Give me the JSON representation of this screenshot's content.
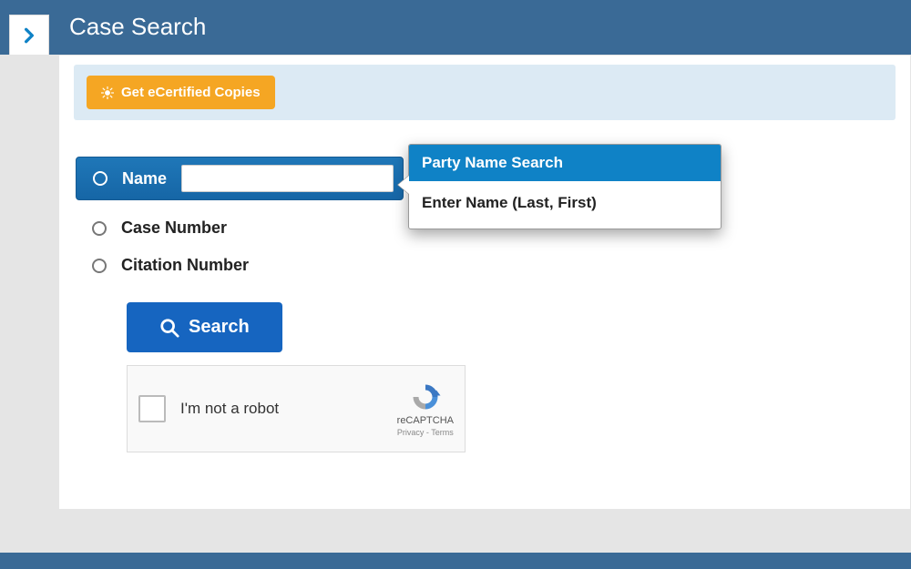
{
  "header": {
    "title": "Case Search"
  },
  "info_strip": {
    "ecert_label": "Get eCertified Copies"
  },
  "search": {
    "options": {
      "name": {
        "label": "Name",
        "selected": true
      },
      "case": {
        "label": "Case Number",
        "selected": false
      },
      "citation": {
        "label": "Citation Number",
        "selected": false
      }
    },
    "name_value": "",
    "submit_label": "Search"
  },
  "tooltip": {
    "title": "Party Name Search",
    "body": "Enter Name (Last, First)"
  },
  "captcha": {
    "text": "I'm not a robot",
    "brand": "reCAPTCHA",
    "legal": "Privacy - Terms"
  }
}
